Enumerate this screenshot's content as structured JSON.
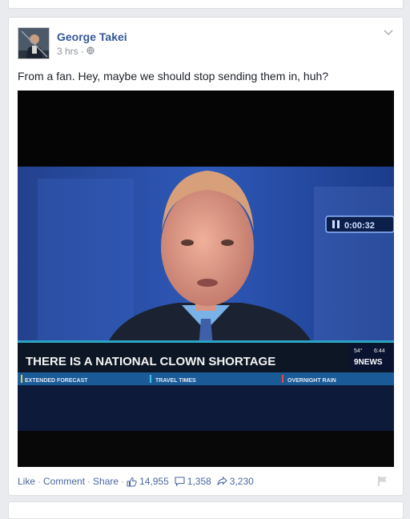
{
  "post": {
    "author": "George Takei",
    "time": "3 hrs",
    "dot": "·",
    "text": "From a fan. Hey, maybe we should stop sending them in, huh?",
    "image": {
      "headline": "THERE IS A NATIONAL CLOWN SHORTAGE",
      "timer": "0:00:32",
      "temp": "54°",
      "clock": "6:44",
      "channel": "9NEWS",
      "ticker": [
        "EXTENDED FORECAST",
        "TRAVEL TIMES",
        "OVERNIGHT RAIN"
      ]
    },
    "actions": {
      "like": "Like",
      "comment": "Comment",
      "share": "Share",
      "sep": "·",
      "like_count": "14,955",
      "comment_count": "1,358",
      "share_count": "3,230"
    }
  },
  "icons": [
    "globe-icon",
    "chevron-down-icon",
    "thumbs-up-icon",
    "comment-icon",
    "share-icon",
    "flag-icon"
  ],
  "colors": {
    "link": "#365899",
    "action": "#4b67a1",
    "lower_third": "#0d1624",
    "ticker_bar": "#1a5a96"
  }
}
